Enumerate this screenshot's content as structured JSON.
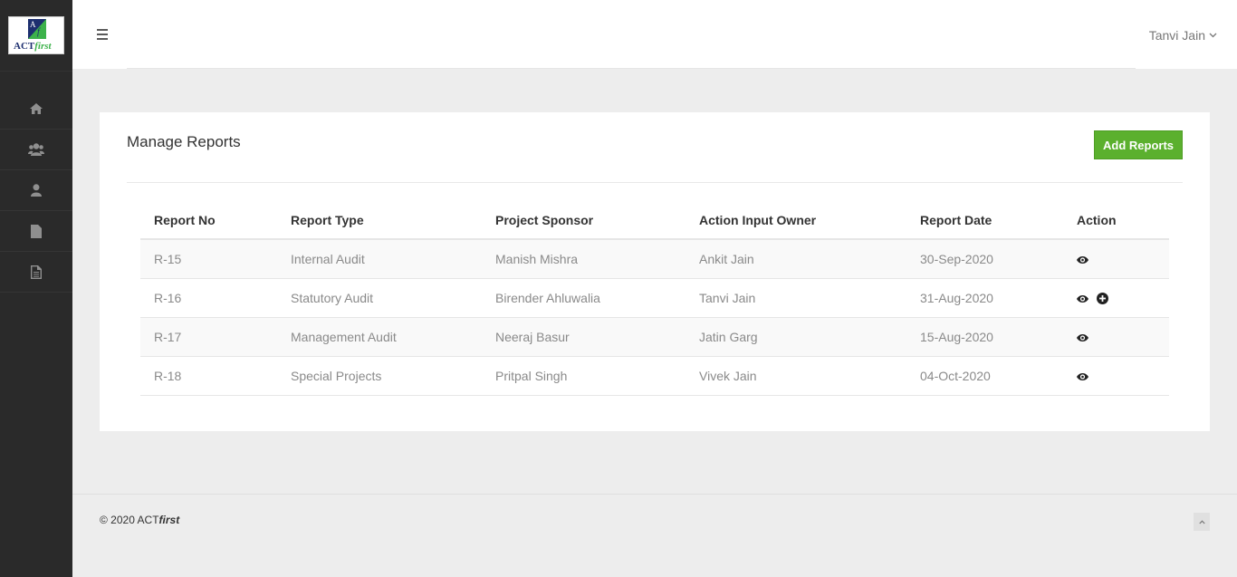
{
  "logo": {
    "mark_letter_a": "A",
    "mark_letter_f": "f",
    "name_plain": "ACT",
    "name_italic": "first"
  },
  "sidebar": {
    "items": [
      {
        "icon": "home-icon"
      },
      {
        "icon": "users-icon"
      },
      {
        "icon": "user-icon"
      },
      {
        "icon": "file-icon"
      },
      {
        "icon": "file-text-icon"
      }
    ]
  },
  "header": {
    "user_name": "Tanvi Jain"
  },
  "page": {
    "title": "Manage Reports",
    "add_button": "Add Reports",
    "table": {
      "columns": [
        "Report No",
        "Report Type",
        "Project Sponsor",
        "Action Input Owner",
        "Report Date",
        "Action"
      ],
      "rows": [
        {
          "no": "R-15",
          "type": "Internal Audit",
          "sponsor": "Manish Mishra",
          "owner": "Ankit Jain",
          "date": "30-Sep-2020",
          "actions": [
            "view-icon"
          ]
        },
        {
          "no": "R-16",
          "type": "Statutory Audit",
          "sponsor": "Birender Ahluwalia",
          "owner": "Tanvi Jain",
          "date": "31-Aug-2020",
          "actions": [
            "view-icon",
            "add-circle-icon"
          ]
        },
        {
          "no": "R-17",
          "type": "Management Audit",
          "sponsor": "Neeraj Basur",
          "owner": "Jatin Garg",
          "date": "15-Aug-2020",
          "actions": [
            "view-icon"
          ]
        },
        {
          "no": "R-18",
          "type": "Special Projects",
          "sponsor": "Pritpal Singh",
          "owner": "Vivek Jain",
          "date": "04-Oct-2020",
          "actions": [
            "view-icon"
          ]
        }
      ]
    }
  },
  "footer": {
    "copyright_prefix": "© 2020 ACT",
    "copyright_italic": "first"
  },
  "colors": {
    "sidebar": "#2a2a2a",
    "accent_green": "#5bb02e",
    "logo_navy": "#1d2f6f",
    "logo_green": "#3cb24a"
  }
}
